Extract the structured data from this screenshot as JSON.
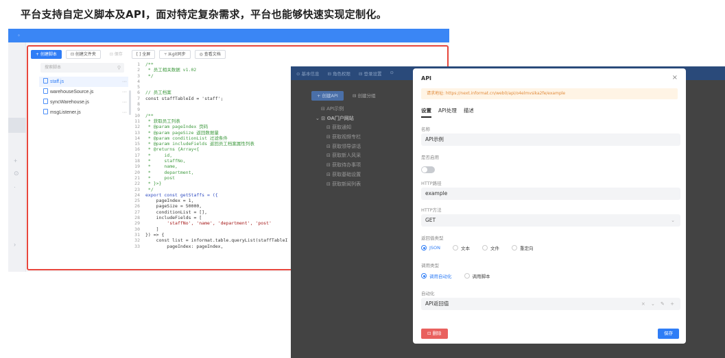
{
  "headline": "平台支持自定义脚本及API，面对特定复杂需求，平台也能够快速实现定制化。",
  "editor": {
    "toolbar": {
      "new_script": "+ 创建脚本",
      "new_folder": "⊡ 创建文件夹",
      "save": "⊡ 保存",
      "fullscreen": "[ ] 全屏",
      "git_sync": "⑂ 从git同步",
      "docs": "◎ 查看文档"
    },
    "search_placeholder": "搜索脚本",
    "files": [
      {
        "name": "staff.js",
        "active": true
      },
      {
        "name": "warehouseSource.js",
        "active": false
      },
      {
        "name": "syncWarehouse.js",
        "active": false
      },
      {
        "name": "msgListener.js",
        "active": false
      }
    ],
    "more_glyph": "···",
    "code": [
      {
        "n": "1",
        "t": "/**",
        "k": "c"
      },
      {
        "n": "2",
        "t": " * 员工相关数据 v1.02",
        "k": "c"
      },
      {
        "n": "3",
        "t": " */",
        "k": "c"
      },
      {
        "n": "4",
        "t": "",
        "k": ""
      },
      {
        "n": "5",
        "t": "",
        "k": ""
      },
      {
        "n": "6",
        "t": "// 员工档案",
        "k": "c"
      },
      {
        "n": "7",
        "t": "const staffTableId = 'staff';",
        "k": ""
      },
      {
        "n": "8",
        "t": "",
        "k": ""
      },
      {
        "n": "9",
        "t": "",
        "k": ""
      },
      {
        "n": "10",
        "t": "/**",
        "k": "c"
      },
      {
        "n": "11",
        "t": " * 获取员工列表",
        "k": "c"
      },
      {
        "n": "12",
        "t": " * @param pageIndex 页码",
        "k": "c"
      },
      {
        "n": "13",
        "t": " * @param pageSize 返回数据量",
        "k": "c"
      },
      {
        "n": "14",
        "t": " * @param conditionList 过滤条件",
        "k": "c"
      },
      {
        "n": "15",
        "t": " * @param includeFields 返回员工档案属性列表",
        "k": "c"
      },
      {
        "n": "16",
        "t": " * @returns {Array<{",
        "k": "c"
      },
      {
        "n": "17",
        "t": " *     id,",
        "k": "c"
      },
      {
        "n": "18",
        "t": " *     staffNo,",
        "k": "c"
      },
      {
        "n": "19",
        "t": " *     name,",
        "k": "c"
      },
      {
        "n": "20",
        "t": " *     department,",
        "k": "c"
      },
      {
        "n": "21",
        "t": " *     post",
        "k": "c"
      },
      {
        "n": "22",
        "t": " * }>}",
        "k": "c"
      },
      {
        "n": "23",
        "t": " */",
        "k": "c"
      },
      {
        "n": "24",
        "t": "export const getStaffs = ({",
        "k": "k"
      },
      {
        "n": "25",
        "t": "    pageIndex = 1,",
        "k": ""
      },
      {
        "n": "26",
        "t": "    pageSize = 50000,",
        "k": ""
      },
      {
        "n": "27",
        "t": "    conditionList = [],",
        "k": ""
      },
      {
        "n": "28",
        "t": "    includeFields = [",
        "k": ""
      },
      {
        "n": "29",
        "t": "        'staffNo', 'name', 'department', 'post'",
        "k": "s"
      },
      {
        "n": "30",
        "t": "    ]",
        "k": ""
      },
      {
        "n": "31",
        "t": "}) => {",
        "k": ""
      },
      {
        "n": "32",
        "t": "    const list = informat.table.queryList(staffTableI",
        "k": ""
      },
      {
        "n": "33",
        "t": "        pageIndex: pageIndex,",
        "k": ""
      }
    ]
  },
  "api": {
    "bg_tabs": [
      "⊙ 基本信息",
      "⊟ 角色权限",
      "⊟ 登录设置",
      "⊙"
    ],
    "bg_buttons": {
      "create_api": "+ 创建API",
      "create_group": "⊟ 创建分组"
    },
    "tree": [
      {
        "label": "⊟ API示例",
        "kind": "lvl0"
      },
      {
        "label": "⌄ ⊡ OA门户网站",
        "kind": "grp"
      },
      {
        "label": "⊟ 获取通知",
        "kind": "lvl1"
      },
      {
        "label": "⊟ 获取视频专栏",
        "kind": "lvl1"
      },
      {
        "label": "⊟ 获取领导讲话",
        "kind": "lvl1"
      },
      {
        "label": "⊟ 获取新人风采",
        "kind": "lvl1"
      },
      {
        "label": "⊟ 获取待办事项",
        "kind": "lvl1"
      },
      {
        "label": "⊟ 获取基础设置",
        "kind": "lvl1"
      },
      {
        "label": "⊟ 获取新闻列表",
        "kind": "lvl1"
      }
    ],
    "modal": {
      "title": "API",
      "close_glyph": "×",
      "url": "请求地址: https://next.informat.cn/web0/api/o4elmvsika2fe/example",
      "tabs": [
        "设置",
        "API处理",
        "描述"
      ],
      "name_label": "名称",
      "name_value": "API示例",
      "enabled_label": "是否启用",
      "path_label": "HTTP路径",
      "path_value": "example",
      "method_label": "HTTP方法",
      "method_value": "GET",
      "return_label": "返回值类型",
      "return_options": [
        {
          "label": "JSON",
          "on": true
        },
        {
          "label": "文本",
          "on": false
        },
        {
          "label": "文件",
          "on": false
        },
        {
          "label": "重定向",
          "on": false
        }
      ],
      "call_label": "调用类型",
      "call_options": [
        {
          "label": "调用自动化",
          "on": true
        },
        {
          "label": "调用脚本",
          "on": false
        }
      ],
      "auto_label": "自动化",
      "auto_value": "API返回值",
      "auto_actions": "× ⌄ ✎ +",
      "delete_label": "⊡ 删除",
      "save_label": "保存"
    }
  }
}
